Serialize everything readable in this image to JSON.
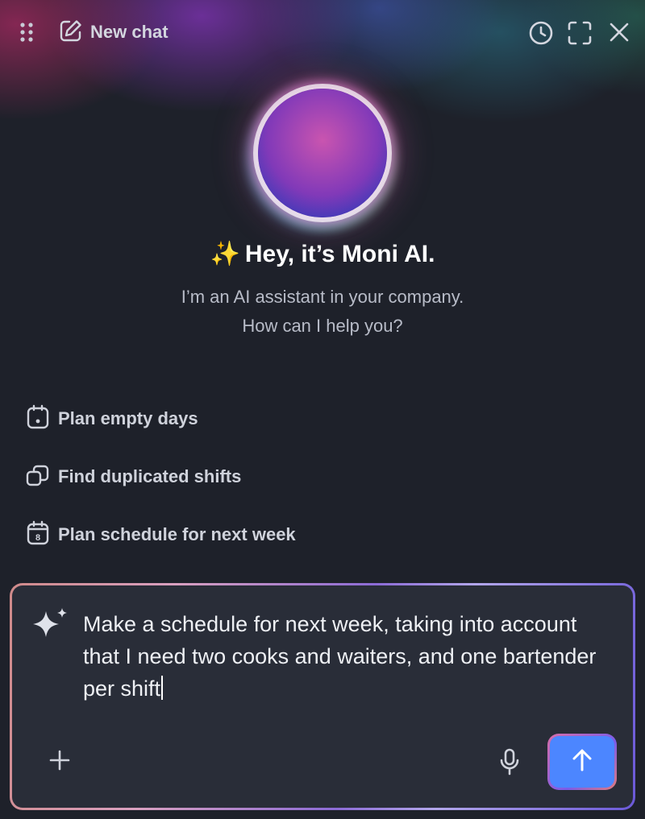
{
  "header": {
    "new_chat_label": "New chat",
    "icons": [
      "drag-handle-icon",
      "edit-icon",
      "history-icon",
      "expand-icon",
      "close-icon"
    ]
  },
  "hero": {
    "title_emoji": "✨",
    "title": "Hey, it’s Moni AI.",
    "subtitle_line1": "I’m an AI assistant in your company.",
    "subtitle_line2": "How can I help you?"
  },
  "suggestions": [
    {
      "icon": "calendar-dot-icon",
      "label": "Plan empty days"
    },
    {
      "icon": "duplicate-icon",
      "label": "Find duplicated shifts"
    },
    {
      "icon": "calendar-8-icon",
      "label": "Plan schedule for next week"
    }
  ],
  "composer": {
    "value": "Make a schedule for next week, taking into account that I need two cooks and waiters, and one bartender per shift",
    "icons": [
      "sparkle-icon",
      "plus-icon",
      "microphone-icon",
      "arrow-up-icon"
    ]
  },
  "colors": {
    "background": "#1e212a",
    "composer_background": "#292d38",
    "send_button": "#4c86ff"
  }
}
